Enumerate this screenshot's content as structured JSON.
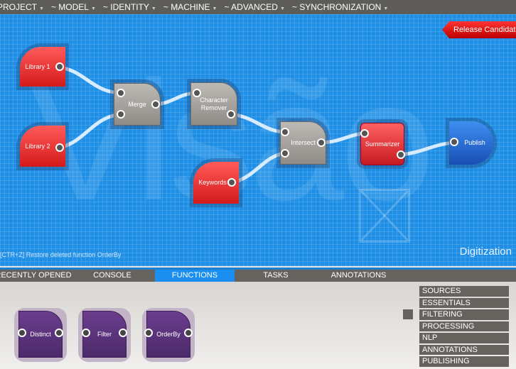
{
  "menu": [
    "PROJECT",
    "~ MODEL",
    "~ IDENTITY",
    "~ MACHINE",
    "~ ADVANCED",
    "~ SYNCHRONIZATION"
  ],
  "canvas": {
    "watermark": "Visão",
    "badge": "Release Candidate",
    "status": "[CTR+Z] Restore deleted function OrderBy",
    "workspace": "Digitization",
    "nodes": {
      "library1": "Library 1",
      "library2": "Library 2",
      "merge": "Merge",
      "charRemover": "Character Remover",
      "keywords": "Keywords",
      "intersect": "Intersect",
      "summarizer": "Summarizer",
      "publish": "Publish"
    }
  },
  "tabs": [
    {
      "label": "RECENTLY OPENED"
    },
    {
      "label": "CONSOLE"
    },
    {
      "label": "FUNCTIONS",
      "active": true
    },
    {
      "label": "TASKS"
    },
    {
      "label": "ANNOTATIONS"
    }
  ],
  "functions": [
    "Distinct",
    "Filter",
    "OrderBy"
  ],
  "categories": [
    "SOURCES",
    "ESSENTIALS",
    "FILTERING",
    "PROCESSING",
    "NLP",
    "ANNOTATIONS",
    "PUBLISHING"
  ],
  "selected_category": "FILTERING",
  "colors": {
    "canvas": "#1f8fe6",
    "source": "#e02424",
    "process": "#a8a5a0",
    "publish": "#2a6fd8",
    "function": "#5a3479",
    "active_tab": "#1a8ff0"
  }
}
